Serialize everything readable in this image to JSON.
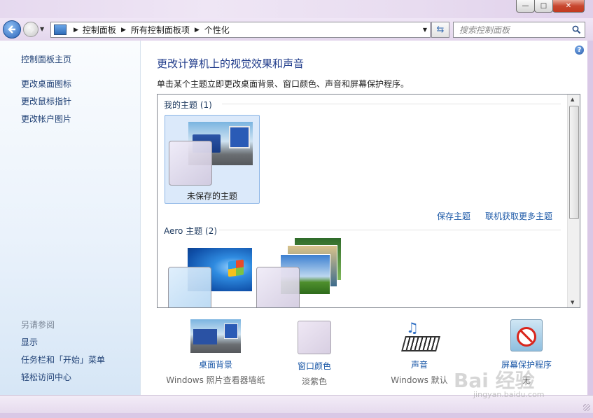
{
  "window": {
    "minimize_glyph": "—",
    "maximize_glyph": "□",
    "close_glyph": "✕"
  },
  "nav": {
    "back_icon": "arrow-left-icon",
    "forward_icon": "arrow-right-icon",
    "breadcrumb": [
      "控制面板",
      "所有控制面板项",
      "个性化"
    ],
    "search_placeholder": "搜索控制面板"
  },
  "sidebar": {
    "home": "控制面板主页",
    "links": [
      "更改桌面图标",
      "更改鼠标指针",
      "更改帐户图片"
    ],
    "see_also_title": "另请参阅",
    "see_also": [
      "显示",
      "任务栏和「开始」菜单",
      "轻松访问中心"
    ]
  },
  "main": {
    "heading": "更改计算机上的视觉效果和声音",
    "description": "单击某个主题立即更改桌面背景、窗口颜色、声音和屏幕保护程序。",
    "my_themes_label": "我的主题 (1)",
    "unsaved_theme": "未保存的主题",
    "save_theme": "保存主题",
    "get_more_themes": "联机获取更多主题",
    "aero_label": "Aero 主题 (2)"
  },
  "bottom": [
    {
      "label": "桌面背景",
      "sub": "Windows 照片查看器墙纸",
      "icon": "wallpaper-icon"
    },
    {
      "label": "窗口颜色",
      "sub": "淡紫色",
      "icon": "window-color-icon"
    },
    {
      "label": "声音",
      "sub": "Windows 默认",
      "icon": "sound-icon"
    },
    {
      "label": "屏幕保护程序",
      "sub": "无",
      "icon": "screensaver-icon"
    }
  ],
  "watermark": {
    "text": "Bai 经验",
    "sub": "jingyan.baidu.com"
  },
  "colors": {
    "link": "#1e5aa8",
    "heading": "#1e3a8a",
    "selection": "#dbe9fa"
  }
}
